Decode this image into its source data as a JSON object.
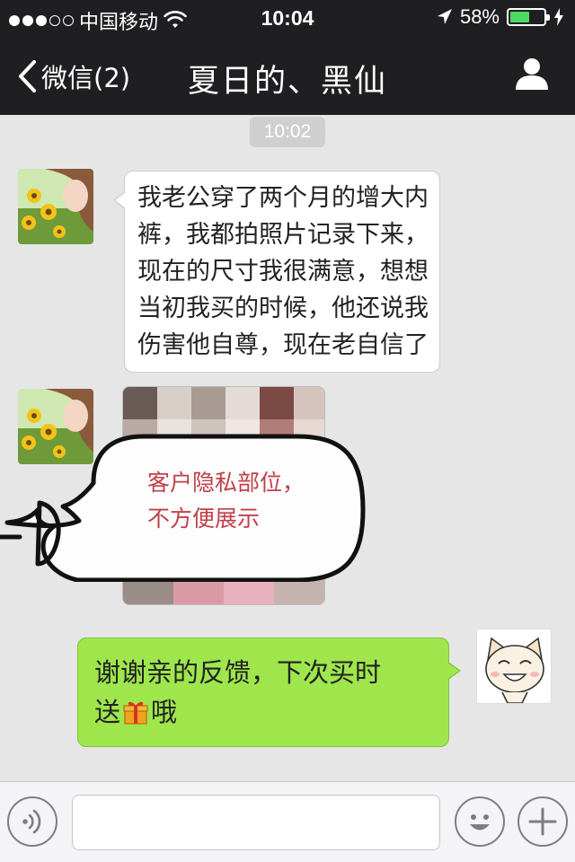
{
  "status_bar": {
    "carrier": "中国移动",
    "time": "10:04",
    "battery_percent_text": "58%",
    "battery_level": 0.58,
    "signal_bars_filled": 3,
    "signal_bars_total": 5
  },
  "nav": {
    "back_label": "微信(2)",
    "title": "夏日的、黑仙"
  },
  "chat": {
    "timestamp": "10:02",
    "messages": [
      {
        "direction": "incoming",
        "type": "text",
        "lines": [
          "我老公穿了两个月的增大内",
          "裤，我都拍照片记录下来，",
          "现在的尺寸我很满意，想想",
          "当初我买的时候，他还说我",
          "伤害他自尊，现在老自信了"
        ]
      },
      {
        "direction": "incoming",
        "type": "image",
        "overlay_note_lines": [
          "客户隐私部位，",
          "不方便展示"
        ]
      },
      {
        "direction": "outgoing",
        "type": "text",
        "line1": "谢谢亲的反馈，下次买时",
        "line2_before": "送",
        "line2_after": "哦",
        "inline_icon": "gift-icon"
      }
    ]
  },
  "input_bar": {
    "text_value": "",
    "left_icon": "voice-icon",
    "right_icons": [
      "emoji-icon",
      "plus-icon"
    ]
  },
  "colors": {
    "bar_bg": "#1f1f21",
    "chat_bg": "#e6e6e6",
    "outgoing_bubble": "#9ee64b",
    "battery_fill": "#4cd964",
    "note_text": "#c0414a"
  }
}
